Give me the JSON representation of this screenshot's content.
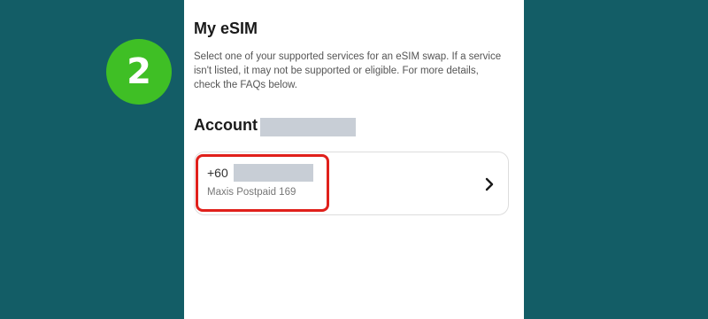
{
  "step": {
    "number": "2"
  },
  "screen": {
    "title": "My eSIM",
    "description": "Select one of your supported services for an eSIM swap. If a service isn't listed, it may not be supported or eligible. For more details, check the FAQs below.",
    "account_label": "Account",
    "account_card": {
      "number_prefix": "+60",
      "plan_name": "Maxis Postpaid 169"
    }
  },
  "colors": {
    "background": "#135d66",
    "badge": "#3fbf25",
    "highlight": "#e0201b",
    "redaction": "#c8ced6"
  },
  "icons": {
    "card_arrow": "chevron-right-icon"
  }
}
